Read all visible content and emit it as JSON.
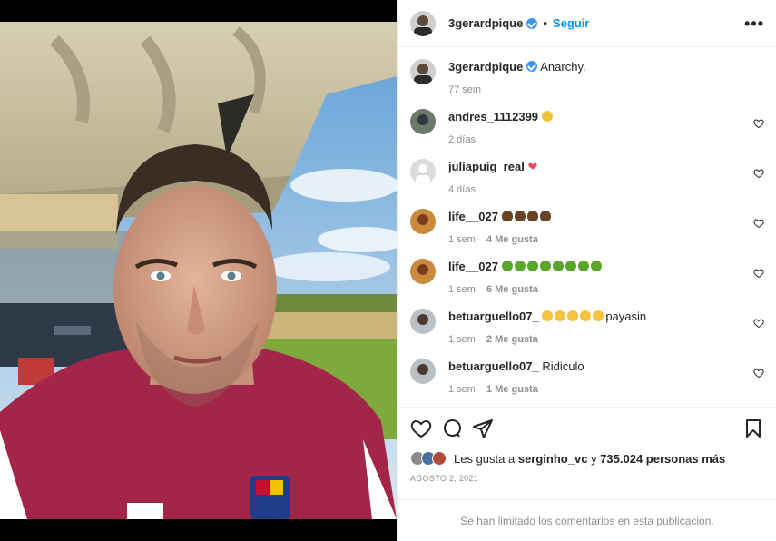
{
  "post": {
    "username": "3gerardpique",
    "follow_label": "Seguir",
    "dot": "•",
    "more_label": "•••",
    "caption": {
      "username": "3gerardpique",
      "text": "Anarchy.",
      "time": "77 sem"
    }
  },
  "comments": [
    {
      "username": "andres_1112399",
      "text": "",
      "emoji": "clap",
      "time": "2 días",
      "likes": ""
    },
    {
      "username": "juliapuig_real",
      "text": "",
      "emoji": "heart",
      "time": "4 días",
      "likes": ""
    },
    {
      "username": "life__027",
      "text": "",
      "emoji": "poop4",
      "time": "1 sem",
      "likes": "4 Me gusta"
    },
    {
      "username": "life__027",
      "text": "",
      "emoji": "sick8",
      "time": "1 sem",
      "likes": "6 Me gusta"
    },
    {
      "username": "betuarguello07_",
      "text": "payasin",
      "emoji": "laugh5",
      "time": "1 sem",
      "likes": "2 Me gusta"
    },
    {
      "username": "betuarguello07_",
      "text": "Ridiculo",
      "emoji": "",
      "time": "1 sem",
      "likes": "1 Me gusta"
    }
  ],
  "likes": {
    "prefix": "Les gusta a",
    "user": "serginho_vc",
    "joiner": "y",
    "count": "735.024 personas más"
  },
  "date": "Agosto 2, 2021",
  "comments_limited": "Se han limitado los comentarios en esta publicación.",
  "icons": [
    "heart-icon",
    "comment-icon",
    "share-icon",
    "bookmark-icon",
    "more-icon",
    "verified-icon"
  ],
  "colors": {
    "accent": "#0095f6",
    "verified": "#3897f0",
    "muted": "#8e8e8e",
    "border": "#efefef"
  }
}
